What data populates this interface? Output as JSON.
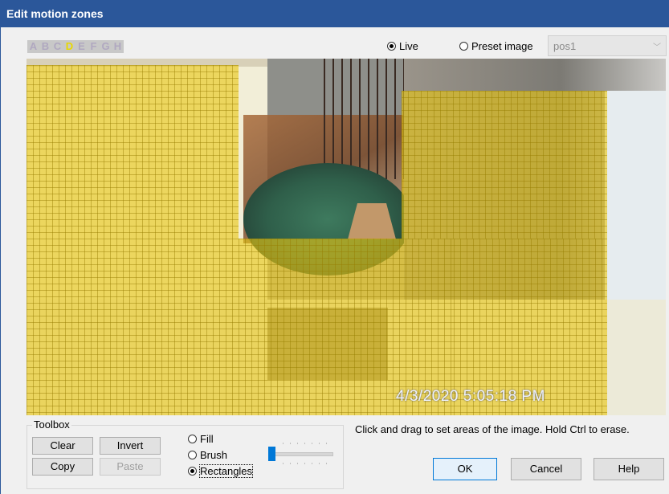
{
  "window": {
    "title": "Edit motion zones"
  },
  "zones": {
    "letters": [
      "A",
      "B",
      "C",
      "D",
      "E",
      "F",
      "G",
      "H"
    ],
    "active": "D",
    "active_color": "#e8d800"
  },
  "source": {
    "live_label": "Live",
    "preset_label": "Preset image",
    "selected": "Live",
    "preset_value": "pos1"
  },
  "camera": {
    "timestamp": "4/3/2020 5:05:18 PM"
  },
  "toolbox": {
    "title": "Toolbox",
    "clear_label": "Clear",
    "invert_label": "Invert",
    "copy_label": "Copy",
    "paste_label": "Paste",
    "modes": [
      "Fill",
      "Brush",
      "Rectangles"
    ],
    "selected_mode": "Rectangles",
    "brush_size_fraction": 0.0
  },
  "hint": "Click and drag to set areas of the image.  Hold Ctrl to erase.",
  "buttons": {
    "ok": "OK",
    "cancel": "Cancel",
    "help": "Help"
  },
  "colors": {
    "title_bar": "#2b579a",
    "zone_fill": "#e8c614",
    "accent": "#0078d7"
  }
}
